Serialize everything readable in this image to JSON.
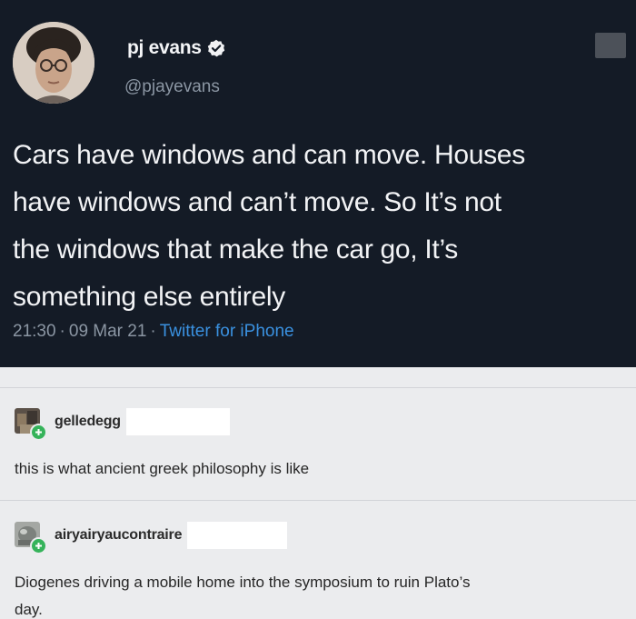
{
  "tweet": {
    "display_name": "pj evans",
    "handle": "@pjayevans",
    "text_lines": [
      "Cars have windows and can move. Houses",
      "have windows and can’t move. So It’s not",
      "the windows that make the car go, It’s",
      "something else entirely"
    ],
    "time": "21:30",
    "date": "09 Mar 21",
    "source": "Twitter for iPhone",
    "badge_color": "#1d9bf0",
    "background": "#141b26"
  },
  "replies": [
    {
      "username": "gelledegg",
      "text": "this is what ancient greek philosophy is like"
    },
    {
      "username": "airyairyaucontraire",
      "text_lines": [
        "Diogenes driving a mobile home into the symposium to ruin Plato’s",
        "day."
      ]
    }
  ],
  "icons": {
    "verified": "verified-badge-icon",
    "follow": "follow-plus-icon"
  },
  "colors": {
    "follow_badge": "#35b35a",
    "link": "#3a91e0",
    "thread_bg": "#ebecee"
  }
}
